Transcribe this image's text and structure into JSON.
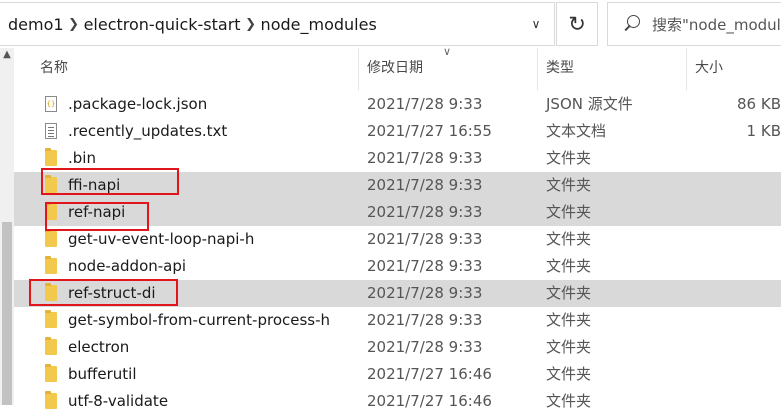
{
  "breadcrumb": [
    {
      "label": "demo1"
    },
    {
      "label": "electron-quick-start"
    },
    {
      "label": "node_modules"
    }
  ],
  "search": {
    "text": "搜索\"node_modules\""
  },
  "columns": {
    "name": "名称",
    "date": "修改日期",
    "type": "类型",
    "size": "大小"
  },
  "files": [
    {
      "name": ".package-lock.json",
      "date": "2021/7/28 9:33",
      "type": "JSON 源文件",
      "size": "86 KB",
      "icon": "json-file-icon",
      "selected": false,
      "highlighted": false
    },
    {
      "name": ".recently_updates.txt",
      "date": "2021/7/27 16:55",
      "type": "文本文档",
      "size": "1 KB",
      "icon": "text-file-icon",
      "selected": false,
      "highlighted": false
    },
    {
      "name": ".bin",
      "date": "2021/7/28 9:33",
      "type": "文件夹",
      "size": "",
      "icon": "folder-icon",
      "selected": false,
      "highlighted": false
    },
    {
      "name": "ffi-napi",
      "date": "2021/7/28 9:33",
      "type": "文件夹",
      "size": "",
      "icon": "folder-icon",
      "selected": true,
      "highlighted": true
    },
    {
      "name": "ref-napi",
      "date": "2021/7/28 9:33",
      "type": "文件夹",
      "size": "",
      "icon": "folder-icon",
      "selected": true,
      "highlighted": true
    },
    {
      "name": "get-uv-event-loop-napi-h",
      "date": "2021/7/28 9:33",
      "type": "文件夹",
      "size": "",
      "icon": "folder-icon",
      "selected": false,
      "highlighted": false
    },
    {
      "name": "node-addon-api",
      "date": "2021/7/28 9:33",
      "type": "文件夹",
      "size": "",
      "icon": "folder-icon",
      "selected": false,
      "highlighted": false
    },
    {
      "name": "ref-struct-di",
      "date": "2021/7/28 9:33",
      "type": "文件夹",
      "size": "",
      "icon": "folder-icon",
      "selected": true,
      "highlighted": true
    },
    {
      "name": "get-symbol-from-current-process-h",
      "date": "2021/7/28 9:33",
      "type": "文件夹",
      "size": "",
      "icon": "folder-icon",
      "selected": false,
      "highlighted": false
    },
    {
      "name": "electron",
      "date": "2021/7/28 9:33",
      "type": "文件夹",
      "size": "",
      "icon": "folder-icon",
      "selected": false,
      "highlighted": false
    },
    {
      "name": "bufferutil",
      "date": "2021/7/27 16:46",
      "type": "文件夹",
      "size": "",
      "icon": "folder-icon",
      "selected": false,
      "highlighted": false
    },
    {
      "name": "utf-8-validate",
      "date": "2021/7/27 16:46",
      "type": "文件夹",
      "size": "",
      "icon": "folder-icon",
      "selected": false,
      "highlighted": false
    }
  ],
  "colors": {
    "selection": "#d9d9d9",
    "highlight_border": "#e0161c",
    "folder": "#f2c94c"
  }
}
